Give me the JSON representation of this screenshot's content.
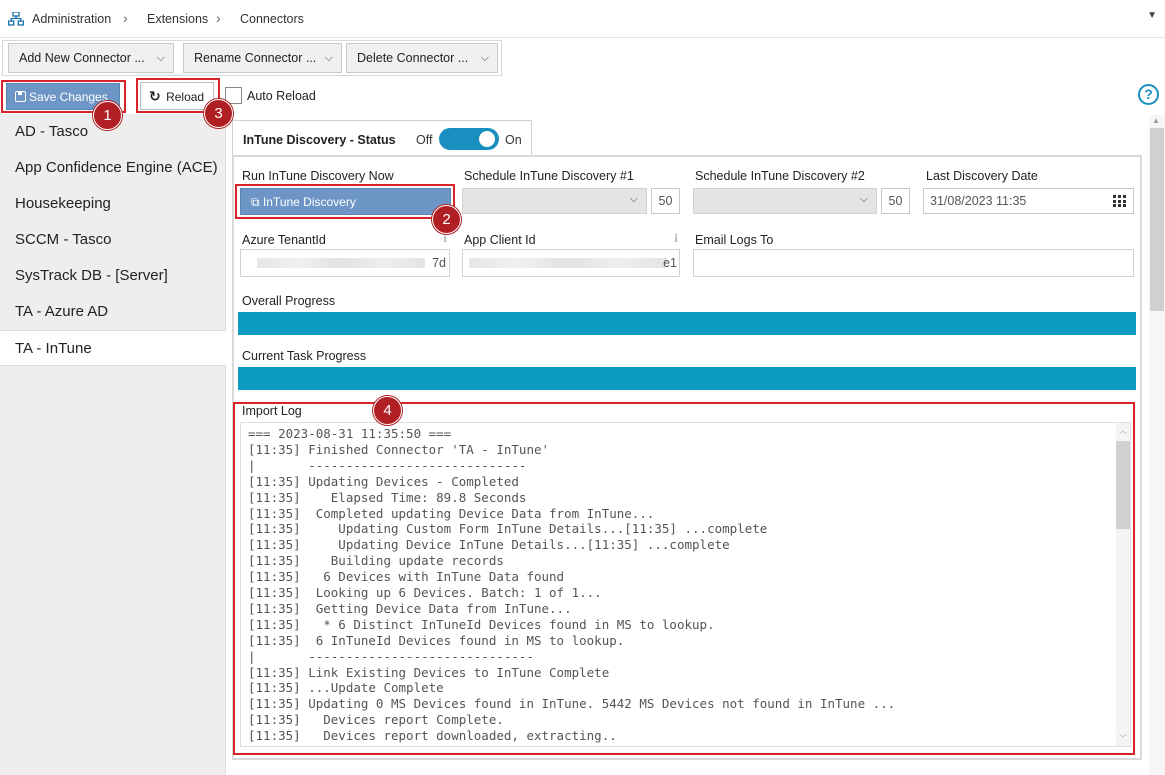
{
  "breadcrumb": [
    "Administration",
    "Extensions",
    "Connectors"
  ],
  "toolbar": {
    "add_label": "Add New Connector ...",
    "rename_label": "Rename Connector ...",
    "delete_label": "Delete Connector ..."
  },
  "actions": {
    "save_label": "Save Changes",
    "reload_label": "Reload",
    "auto_reload_label": "Auto Reload",
    "help_glyph": "?"
  },
  "badges": [
    "1",
    "2",
    "3",
    "4"
  ],
  "sidebar": {
    "items": [
      {
        "label": "AD - Tasco"
      },
      {
        "label": "App Confidence Engine (ACE)"
      },
      {
        "label": "Housekeeping"
      },
      {
        "label": "SCCM - Tasco"
      },
      {
        "label": "SysTrack DB - [Server]"
      },
      {
        "label": "TA - Azure AD"
      },
      {
        "label": "TA - InTune"
      }
    ],
    "active_index": 6
  },
  "status": {
    "title": "InTune Discovery - Status",
    "off_label": "Off",
    "on_label": "On",
    "enabled": true
  },
  "form": {
    "run_label": "Run InTune Discovery Now",
    "run_button": "InTune Discovery",
    "schedule1_label": "Schedule InTune Discovery #1",
    "schedule1_num": "50",
    "schedule2_label": "Schedule InTune Discovery #2",
    "schedule2_num": "50",
    "last_date_label": "Last Discovery Date",
    "last_date_value": "31/08/2023 11:35",
    "tenant_label": "Azure TenantId",
    "tenant_value_tail": "7d",
    "client_label": "App Client Id",
    "client_value_tail": "e1",
    "email_label": "Email Logs To",
    "email_value": "",
    "overall_label": "Overall Progress",
    "overall_progress": 1.0,
    "task_label": "Current Task Progress",
    "task_progress": 1.0
  },
  "log": {
    "label": "Import Log",
    "lines": [
      "=== 2023-08-31 11:35:50 ===",
      "[11:35] Finished Connector 'TA - InTune'",
      "|       -----------------------------",
      "[11:35] Updating Devices - Completed",
      "[11:35]    Elapsed Time: 89.8 Seconds",
      "[11:35]  Completed updating Device Data from InTune...",
      "[11:35]     Updating Custom Form InTune Details...[11:35] ...complete",
      "[11:35]     Updating Device InTune Details...[11:35] ...complete",
      "[11:35]    Building update records",
      "[11:35]   6 Devices with InTune Data found",
      "[11:35]  Looking up 6 Devices. Batch: 1 of 1...",
      "[11:35]  Getting Device Data from InTune...",
      "[11:35]   * 6 Distinct InTuneId Devices found in MS to lookup.",
      "[11:35]  6 InTuneId Devices found in MS to lookup.",
      "|       ------------------------------",
      "[11:35] Link Existing Devices to InTune Complete",
      "[11:35] ...Update Complete",
      "[11:35] Updating 0 MS Devices found in InTune. 5442 MS Devices not found in InTune ...",
      "[11:35]   Devices report Complete.",
      "[11:35]   Devices report downloaded, extracting.."
    ]
  },
  "colors": {
    "accent": "#1a8fbf",
    "progress": "#0d9bbf",
    "button": "#6d95c6",
    "highlight": "#d6242a",
    "badge": "#b01f24"
  }
}
